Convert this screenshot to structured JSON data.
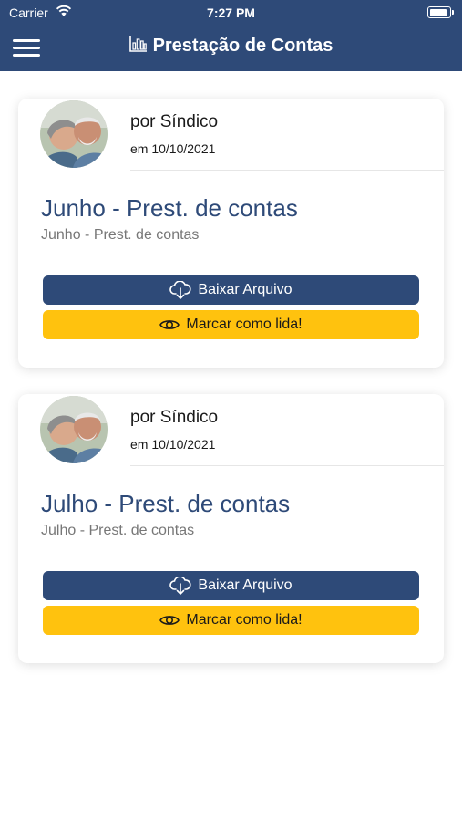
{
  "status_bar": {
    "carrier": "Carrier",
    "time": "7:27 PM",
    "battery_level": 0.9,
    "icons": [
      "wifi-icon",
      "battery-icon"
    ]
  },
  "header": {
    "title": "Prestação de Contas",
    "menu_icon": "hamburger-menu-icon",
    "title_icon": "bar-chart-icon",
    "background_color": "#2e4a78"
  },
  "cards": [
    {
      "author": "por Síndico",
      "date": "em 10/10/2021",
      "title": "Junho - Prest. de contas",
      "subtitle": "Junho - Prest. de contas",
      "download_label": "Baixar Arquivo",
      "mark_read_label": "Marcar como lida!"
    },
    {
      "author": "por Síndico",
      "date": "em 10/10/2021",
      "title": "Julho - Prest. de contas",
      "subtitle": "Julho - Prest. de contas",
      "download_label": "Baixar Arquivo",
      "mark_read_label": "Marcar como lida!"
    }
  ],
  "colors": {
    "primary": "#2e4a78",
    "accent": "#ffc20e"
  }
}
